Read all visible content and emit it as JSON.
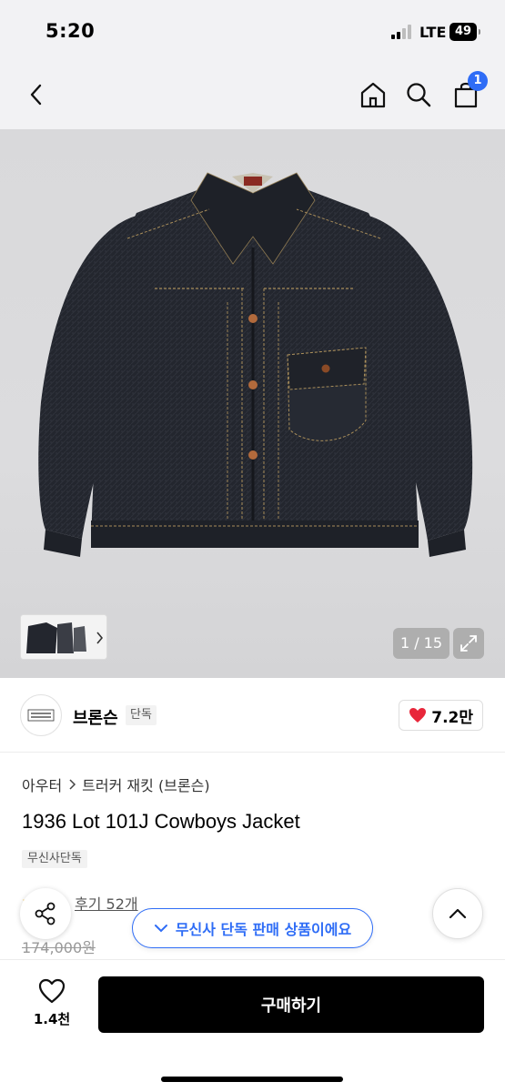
{
  "status_bar": {
    "time": "5:20",
    "network": "LTE",
    "battery": "49"
  },
  "nav": {
    "cart_count": "1"
  },
  "gallery": {
    "counter": "1 / 15"
  },
  "brand": {
    "name": "브론슨",
    "tag": "단독",
    "likes": "7.2만"
  },
  "product": {
    "breadcrumb": [
      "아우터",
      "트러커 재킷 (브론슨)"
    ],
    "title": "1936 Lot 101J Cowboys Jacket",
    "tag": "무신사단독",
    "reviews": "후기 52개",
    "original_price": "174,000원"
  },
  "floating": {
    "exclusive_notice": "무신사 단독 판매 상품이에요"
  },
  "bottom": {
    "wish_count": "1.4천",
    "buy_label": "구매하기"
  },
  "colors": {
    "accent": "#2f6df6",
    "heart": "#e8263a",
    "denim": "#23262e"
  }
}
